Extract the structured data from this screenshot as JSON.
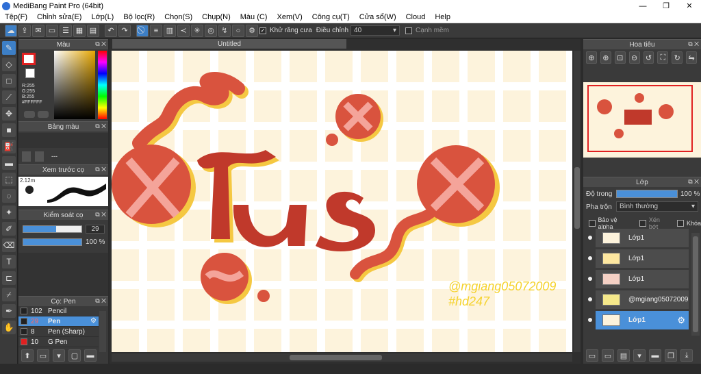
{
  "window": {
    "title": "MediBang Paint Pro (64bit)"
  },
  "menu": [
    "Tệp(F)",
    "Chỉnh sửa(E)",
    "Lớp(L)",
    "Bộ lọc(R)",
    "Chọn(S)",
    "Chụp(N)",
    "Màu (C)",
    "Xem(V)",
    "Công cụ(T)",
    "Cửa sổ(W)",
    "Cloud",
    "Help"
  ],
  "toolbar": {
    "antialias_label": "Khử răng cưa",
    "adjust_label": "Điều chỉnh",
    "adjust_value": "40",
    "edge_label": "Cạnh mềm"
  },
  "panels": {
    "color": {
      "title": "Màu",
      "r": "R:255",
      "g": "G:255",
      "b": "B:255",
      "hex": "#FFFFFF"
    },
    "palette": {
      "title": "Bảng màu",
      "dash": "---"
    },
    "brush_preview": {
      "title": "Xem trước cọ",
      "size": "2.12m"
    },
    "brush_control": {
      "title": "Kiểm soát cọ",
      "size_value": "29",
      "opacity_value": "100 %"
    },
    "brush_list": {
      "title": "Cọ: Pen",
      "items": [
        {
          "num": "102",
          "name": "Pencil"
        },
        {
          "num": "29",
          "name": "Pen"
        },
        {
          "num": "8",
          "name": "Pen (Sharp)"
        },
        {
          "num": "10",
          "name": "G Pen"
        }
      ]
    }
  },
  "canvas": {
    "tab": "Untitled",
    "watermark_line1": "@mgiang05072009",
    "watermark_line2": "#hd247"
  },
  "navigator": {
    "title": "Hoa tiêu"
  },
  "layers": {
    "title": "Lớp",
    "opacity_label": "Độ trong",
    "opacity_value": "100 %",
    "blend_label": "Pha trộn",
    "blend_value": "Bình thường",
    "protect_alpha": "Bảo vệ alpha",
    "clipping": "Xén bớt",
    "lock": "Khóa",
    "items": [
      {
        "name": "Lớp1"
      },
      {
        "name": "Lớp1"
      },
      {
        "name": "Lớp1"
      },
      {
        "name": "@mgiang05072009"
      },
      {
        "name": "Lớp1"
      }
    ]
  },
  "colors": {
    "accent": "#4a90d9",
    "canvas_bg": "#fdf3dc",
    "art_red": "#d9533e",
    "art_yellow": "#f5c842"
  }
}
